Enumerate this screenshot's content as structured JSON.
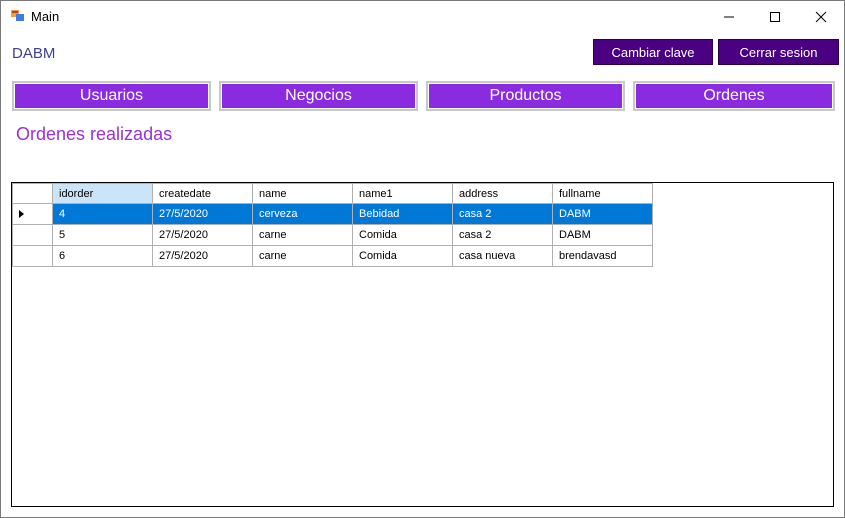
{
  "window": {
    "title": "Main"
  },
  "header": {
    "user": "DABM",
    "change_password_label": "Cambiar clave",
    "logout_label": "Cerrar sesion"
  },
  "nav": {
    "usuarios": "Usuarios",
    "negocios": "Negocios",
    "productos": "Productos",
    "ordenes": "Ordenes"
  },
  "section_title": "Ordenes realizadas",
  "table": {
    "columns": [
      "idorder",
      "createdate",
      "name",
      "name1",
      "address",
      "fullname"
    ],
    "rows": [
      [
        "4",
        "27/5/2020",
        "cerveza",
        "Bebidad",
        "casa 2",
        "DABM"
      ],
      [
        "5",
        "27/5/2020",
        "carne",
        "Comida",
        "casa 2",
        "DABM"
      ],
      [
        "6",
        "27/5/2020",
        "carne",
        "Comida",
        "casa nueva",
        "brendavasd"
      ]
    ],
    "selected_row": 0
  },
  "colors": {
    "nav_button": "#8a2be2",
    "top_button": "#4b0082",
    "title_accent": "#9b30d9",
    "selection": "#0078d7"
  }
}
